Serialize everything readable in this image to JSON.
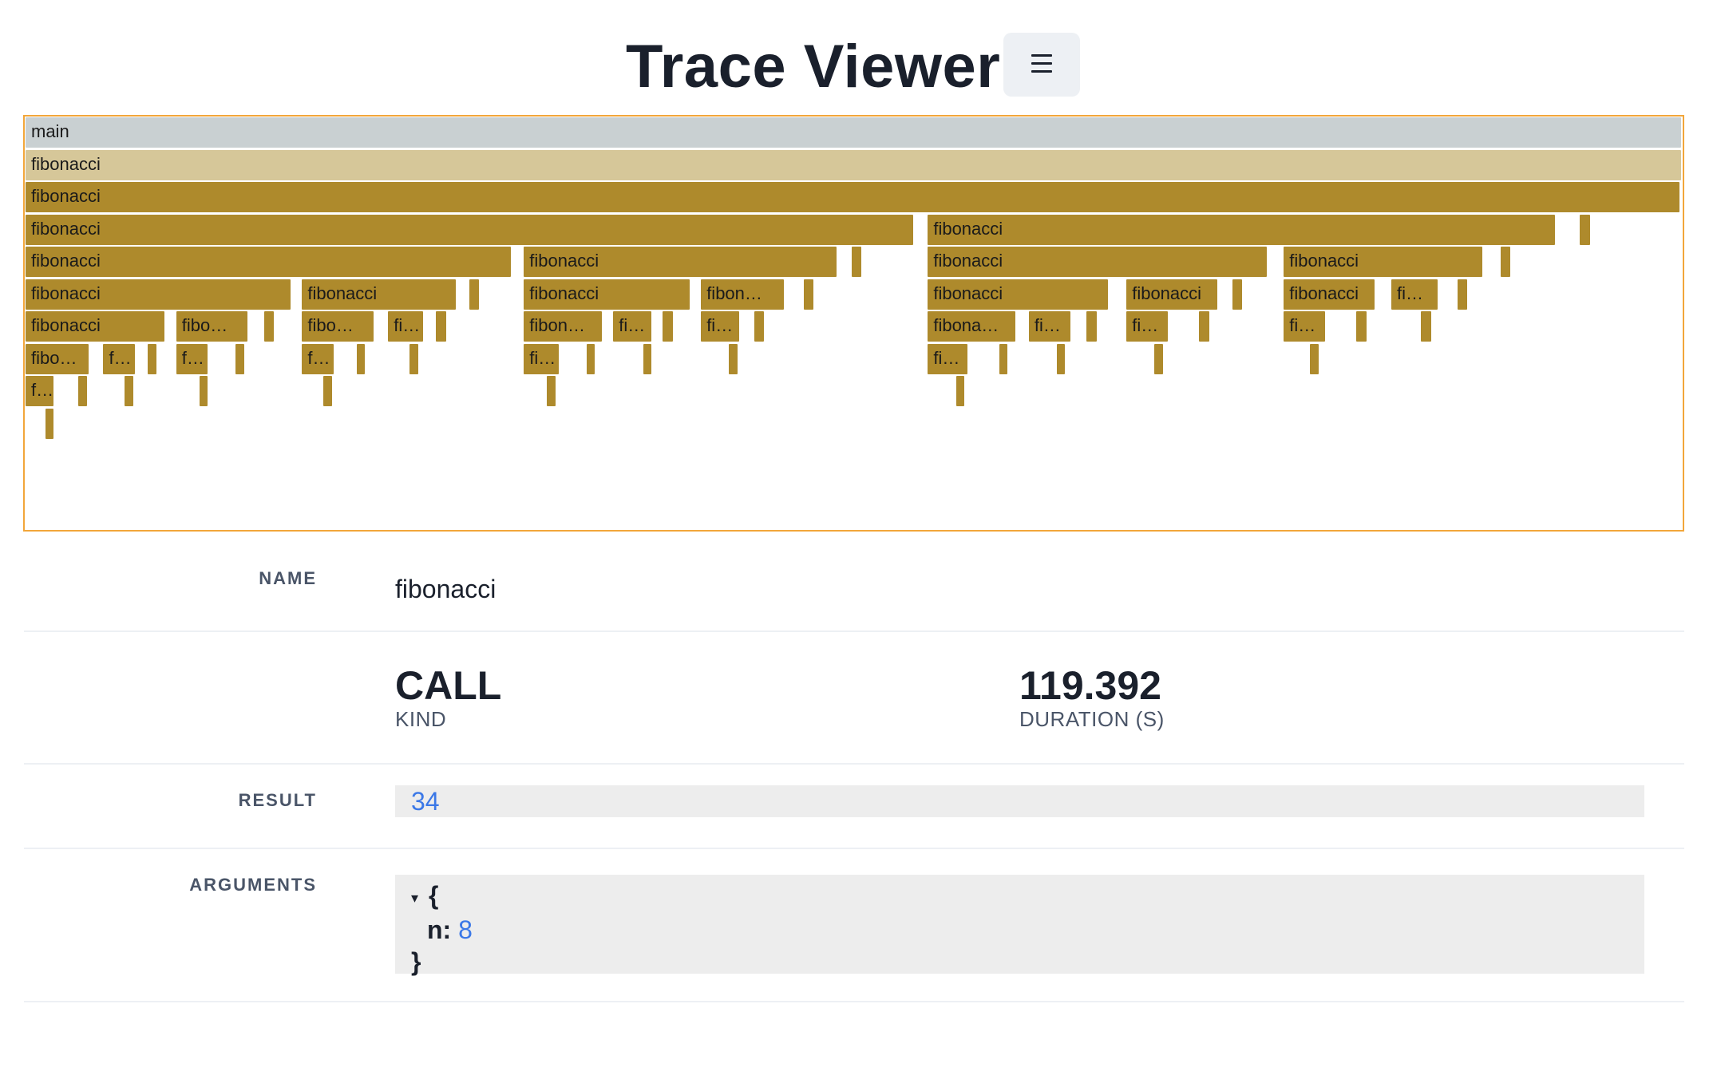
{
  "header": {
    "title": "Trace Viewer",
    "menu_icon": "hamburger-menu-icon"
  },
  "colors": {
    "root": "#c9d0d2",
    "selected": "#d6c799",
    "frame": "#ae8a2c",
    "border": "#f2a63a",
    "value_blue": "#3b78e7"
  },
  "flame_graph": {
    "frames": [
      {
        "label": "main",
        "depth": 0,
        "start": 0.0,
        "duration": 1.0,
        "kind": "root"
      },
      {
        "label": "fibonacci",
        "depth": 1,
        "start": 0.0,
        "duration": 1.0,
        "kind": "selected"
      },
      {
        "label": "fibonacci",
        "depth": 2,
        "start": 0.0,
        "duration": 0.999
      },
      {
        "label": "fibonacci",
        "depth": 3,
        "start": 0.0,
        "duration": 0.536
      },
      {
        "label": "fibonacci",
        "depth": 3,
        "start": 0.545,
        "duration": 0.379
      },
      {
        "label": "",
        "depth": 3,
        "start": 0.939,
        "duration": 0.006
      },
      {
        "label": "fibonacci",
        "depth": 4,
        "start": 0.0,
        "duration": 0.293
      },
      {
        "label": "fibonacci",
        "depth": 4,
        "start": 0.301,
        "duration": 0.189
      },
      {
        "label": "",
        "depth": 4,
        "start": 0.499,
        "duration": 0.006
      },
      {
        "label": "fibonacci",
        "depth": 4,
        "start": 0.545,
        "duration": 0.205
      },
      {
        "label": "fibonacci",
        "depth": 4,
        "start": 0.76,
        "duration": 0.12
      },
      {
        "label": "",
        "depth": 4,
        "start": 0.891,
        "duration": 0.006
      },
      {
        "label": "fibonacci",
        "depth": 5,
        "start": 0.0,
        "duration": 0.16
      },
      {
        "label": "fibonacci",
        "depth": 5,
        "start": 0.167,
        "duration": 0.093
      },
      {
        "label": "",
        "depth": 5,
        "start": 0.268,
        "duration": 0.006
      },
      {
        "label": "fibonacci",
        "depth": 5,
        "start": 0.301,
        "duration": 0.1
      },
      {
        "label": "fibon…",
        "depth": 5,
        "start": 0.408,
        "duration": 0.05
      },
      {
        "label": "",
        "depth": 5,
        "start": 0.47,
        "duration": 0.006
      },
      {
        "label": "fibonacci",
        "depth": 5,
        "start": 0.545,
        "duration": 0.109
      },
      {
        "label": "fibonacci",
        "depth": 5,
        "start": 0.665,
        "duration": 0.055
      },
      {
        "label": "",
        "depth": 5,
        "start": 0.729,
        "duration": 0.006
      },
      {
        "label": "fibonacci",
        "depth": 5,
        "start": 0.76,
        "duration": 0.055
      },
      {
        "label": "fi…",
        "depth": 5,
        "start": 0.825,
        "duration": 0.028
      },
      {
        "label": "",
        "depth": 5,
        "start": 0.865,
        "duration": 0.006
      },
      {
        "label": "fibonacci",
        "depth": 6,
        "start": 0.0,
        "duration": 0.084
      },
      {
        "label": "fibo…",
        "depth": 6,
        "start": 0.091,
        "duration": 0.043
      },
      {
        "label": "",
        "depth": 6,
        "start": 0.144,
        "duration": 0.006
      },
      {
        "label": "fibo…",
        "depth": 6,
        "start": 0.167,
        "duration": 0.043
      },
      {
        "label": "fi…",
        "depth": 6,
        "start": 0.219,
        "duration": 0.021
      },
      {
        "label": "",
        "depth": 6,
        "start": 0.248,
        "duration": 0.006
      },
      {
        "label": "fibon…",
        "depth": 6,
        "start": 0.301,
        "duration": 0.047
      },
      {
        "label": "fi…",
        "depth": 6,
        "start": 0.355,
        "duration": 0.023
      },
      {
        "label": "",
        "depth": 6,
        "start": 0.385,
        "duration": 0.006
      },
      {
        "label": "fi…",
        "depth": 6,
        "start": 0.408,
        "duration": 0.023
      },
      {
        "label": "",
        "depth": 6,
        "start": 0.44,
        "duration": 0.006
      },
      {
        "label": "fibona…",
        "depth": 6,
        "start": 0.545,
        "duration": 0.053
      },
      {
        "label": "fi…",
        "depth": 6,
        "start": 0.606,
        "duration": 0.025
      },
      {
        "label": "",
        "depth": 6,
        "start": 0.641,
        "duration": 0.006
      },
      {
        "label": "fi…",
        "depth": 6,
        "start": 0.665,
        "duration": 0.025
      },
      {
        "label": "",
        "depth": 6,
        "start": 0.709,
        "duration": 0.006
      },
      {
        "label": "fi…",
        "depth": 6,
        "start": 0.76,
        "duration": 0.025
      },
      {
        "label": "",
        "depth": 6,
        "start": 0.804,
        "duration": 0.006
      },
      {
        "label": "",
        "depth": 6,
        "start": 0.843,
        "duration": 0.006
      },
      {
        "label": "fibo…",
        "depth": 7,
        "start": 0.0,
        "duration": 0.038
      },
      {
        "label": "fi…",
        "depth": 7,
        "start": 0.047,
        "duration": 0.019
      },
      {
        "label": "",
        "depth": 7,
        "start": 0.074,
        "duration": 0.005
      },
      {
        "label": "fi…",
        "depth": 7,
        "start": 0.091,
        "duration": 0.019
      },
      {
        "label": "",
        "depth": 7,
        "start": 0.127,
        "duration": 0.005
      },
      {
        "label": "fi…",
        "depth": 7,
        "start": 0.167,
        "duration": 0.019
      },
      {
        "label": "",
        "depth": 7,
        "start": 0.2,
        "duration": 0.005
      },
      {
        "label": "",
        "depth": 7,
        "start": 0.232,
        "duration": 0.005
      },
      {
        "label": "fi…",
        "depth": 7,
        "start": 0.301,
        "duration": 0.021
      },
      {
        "label": "",
        "depth": 7,
        "start": 0.339,
        "duration": 0.005
      },
      {
        "label": "",
        "depth": 7,
        "start": 0.373,
        "duration": 0.005
      },
      {
        "label": "",
        "depth": 7,
        "start": 0.425,
        "duration": 0.005
      },
      {
        "label": "fi…",
        "depth": 7,
        "start": 0.545,
        "duration": 0.024
      },
      {
        "label": "",
        "depth": 7,
        "start": 0.588,
        "duration": 0.005
      },
      {
        "label": "",
        "depth": 7,
        "start": 0.623,
        "duration": 0.005
      },
      {
        "label": "",
        "depth": 7,
        "start": 0.682,
        "duration": 0.005
      },
      {
        "label": "",
        "depth": 7,
        "start": 0.776,
        "duration": 0.005
      },
      {
        "label": "fi…",
        "depth": 8,
        "start": 0.0,
        "duration": 0.017
      },
      {
        "label": "",
        "depth": 8,
        "start": 0.032,
        "duration": 0.005
      },
      {
        "label": "",
        "depth": 8,
        "start": 0.06,
        "duration": 0.005
      },
      {
        "label": "",
        "depth": 8,
        "start": 0.105,
        "duration": 0.005
      },
      {
        "label": "",
        "depth": 8,
        "start": 0.18,
        "duration": 0.005
      },
      {
        "label": "",
        "depth": 8,
        "start": 0.315,
        "duration": 0.005
      },
      {
        "label": "",
        "depth": 8,
        "start": 0.562,
        "duration": 0.005
      },
      {
        "label": "",
        "depth": 9,
        "start": 0.012,
        "duration": 0.005
      }
    ]
  },
  "details": {
    "name_label": "NAME",
    "name_value": "fibonacci",
    "kind_value": "CALL",
    "kind_label": "KIND",
    "duration_value": "119.392",
    "duration_label": "DURATION (S)",
    "result_label": "RESULT",
    "result_value": "34",
    "arguments_label": "ARGUMENTS",
    "arguments": {
      "toggle": "▾",
      "open_brace": "{",
      "key": "n:",
      "value": "8",
      "close_brace": "}"
    }
  }
}
